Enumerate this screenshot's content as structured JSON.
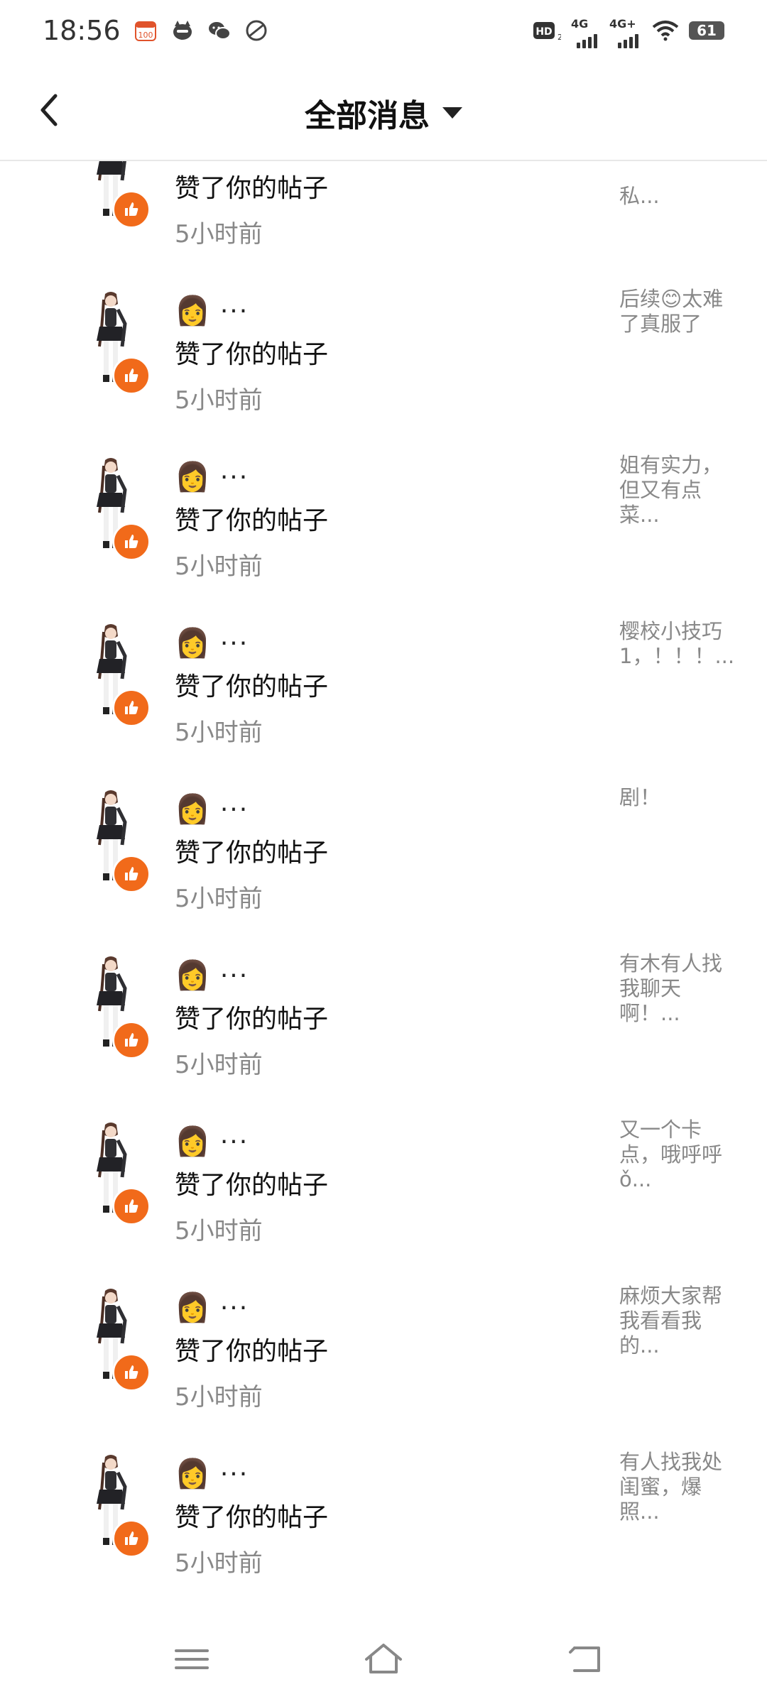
{
  "status_bar": {
    "time": "18:56",
    "battery": "61",
    "network_labels": [
      "HD",
      "4G",
      "4G+"
    ],
    "icons": [
      "calendar-icon",
      "cat-app-icon",
      "wechat-icon",
      "leaf-app-icon",
      "wifi-icon",
      "battery-icon"
    ]
  },
  "header": {
    "title": "全部消息",
    "back_icon": "chevron-left-icon",
    "dropdown_icon": "caret-down-icon"
  },
  "colors": {
    "like_badge": "#f16a1a",
    "secondary_text": "#888888",
    "divider": "#e8e8e8"
  },
  "notifications": [
    {
      "name_emoji": "",
      "name_suffix": "",
      "action": "赞了你的帖子",
      "time": "5小时前",
      "preview": "私..."
    },
    {
      "name_emoji": "👩",
      "name_suffix": "···",
      "action": "赞了你的帖子",
      "time": "5小时前",
      "preview": "后续😊太难了真服了"
    },
    {
      "name_emoji": "👩",
      "name_suffix": "···",
      "action": "赞了你的帖子",
      "time": "5小时前",
      "preview": "姐有实力，但又有点菜..."
    },
    {
      "name_emoji": "👩",
      "name_suffix": "···",
      "action": "赞了你的帖子",
      "time": "5小时前",
      "preview": "樱校小技巧1，！！！..."
    },
    {
      "name_emoji": "👩",
      "name_suffix": "···",
      "action": "赞了你的帖子",
      "time": "5小时前",
      "preview": "剧！"
    },
    {
      "name_emoji": "👩",
      "name_suffix": "···",
      "action": "赞了你的帖子",
      "time": "5小时前",
      "preview": "有木有人找我聊天啊！..."
    },
    {
      "name_emoji": "👩",
      "name_suffix": "···",
      "action": "赞了你的帖子",
      "time": "5小时前",
      "preview": "又一个卡点，哦呼呼ǒ..."
    },
    {
      "name_emoji": "👩",
      "name_suffix": "···",
      "action": "赞了你的帖子",
      "time": "5小时前",
      "preview": "麻烦大家帮我看看我的..."
    },
    {
      "name_emoji": "👩",
      "name_suffix": "···",
      "action": "赞了你的帖子",
      "time": "5小时前",
      "preview": "有人找我处闺蜜，爆照..."
    }
  ],
  "bottom_nav": {
    "icons": [
      "menu-icon",
      "home-icon",
      "back-icon"
    ]
  }
}
